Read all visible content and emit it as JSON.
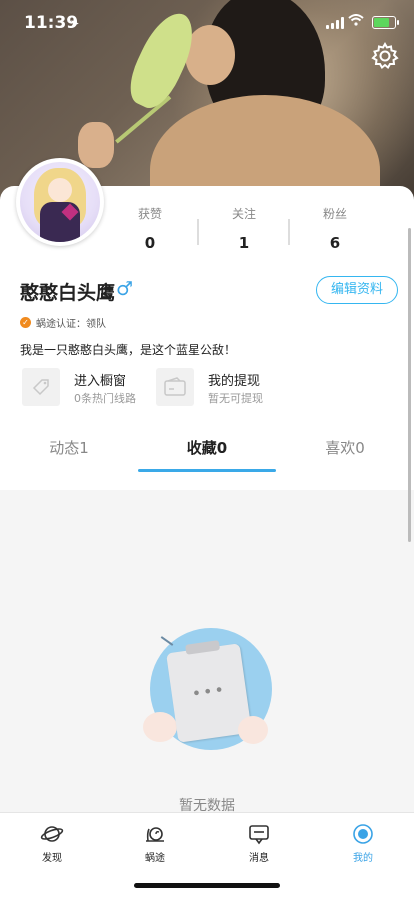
{
  "status_bar": {
    "time": "11:39"
  },
  "profile": {
    "name": "憨憨白头鹰",
    "gender_symbol": "♂",
    "edit_label": "编辑资料",
    "verify_text": "蜗途认证：领队",
    "bio": "我是一只憨憨白头鹰，是这个蓝星公敌！"
  },
  "stats": [
    {
      "label": "获赞",
      "value": "0"
    },
    {
      "label": "关注",
      "value": "1"
    },
    {
      "label": "粉丝",
      "value": "6"
    }
  ],
  "features": [
    {
      "title": "进入橱窗",
      "subtitle": "0条热门线路"
    },
    {
      "title": "我的提现",
      "subtitle": "暂无可提现"
    }
  ],
  "tabs": [
    {
      "label": "动态1"
    },
    {
      "label": "收藏0",
      "active": true
    },
    {
      "label": "喜欢0"
    }
  ],
  "empty": {
    "text": "暂无数据"
  },
  "tabbar": [
    {
      "label": "发现",
      "icon": "planet-icon"
    },
    {
      "label": "蜗途",
      "icon": "snail-icon"
    },
    {
      "label": "消息",
      "icon": "message-icon"
    },
    {
      "label": "我的",
      "icon": "profile-icon",
      "active": true
    }
  ],
  "colors": {
    "accent": "#35b6f0",
    "verify": "#f08a1e"
  }
}
